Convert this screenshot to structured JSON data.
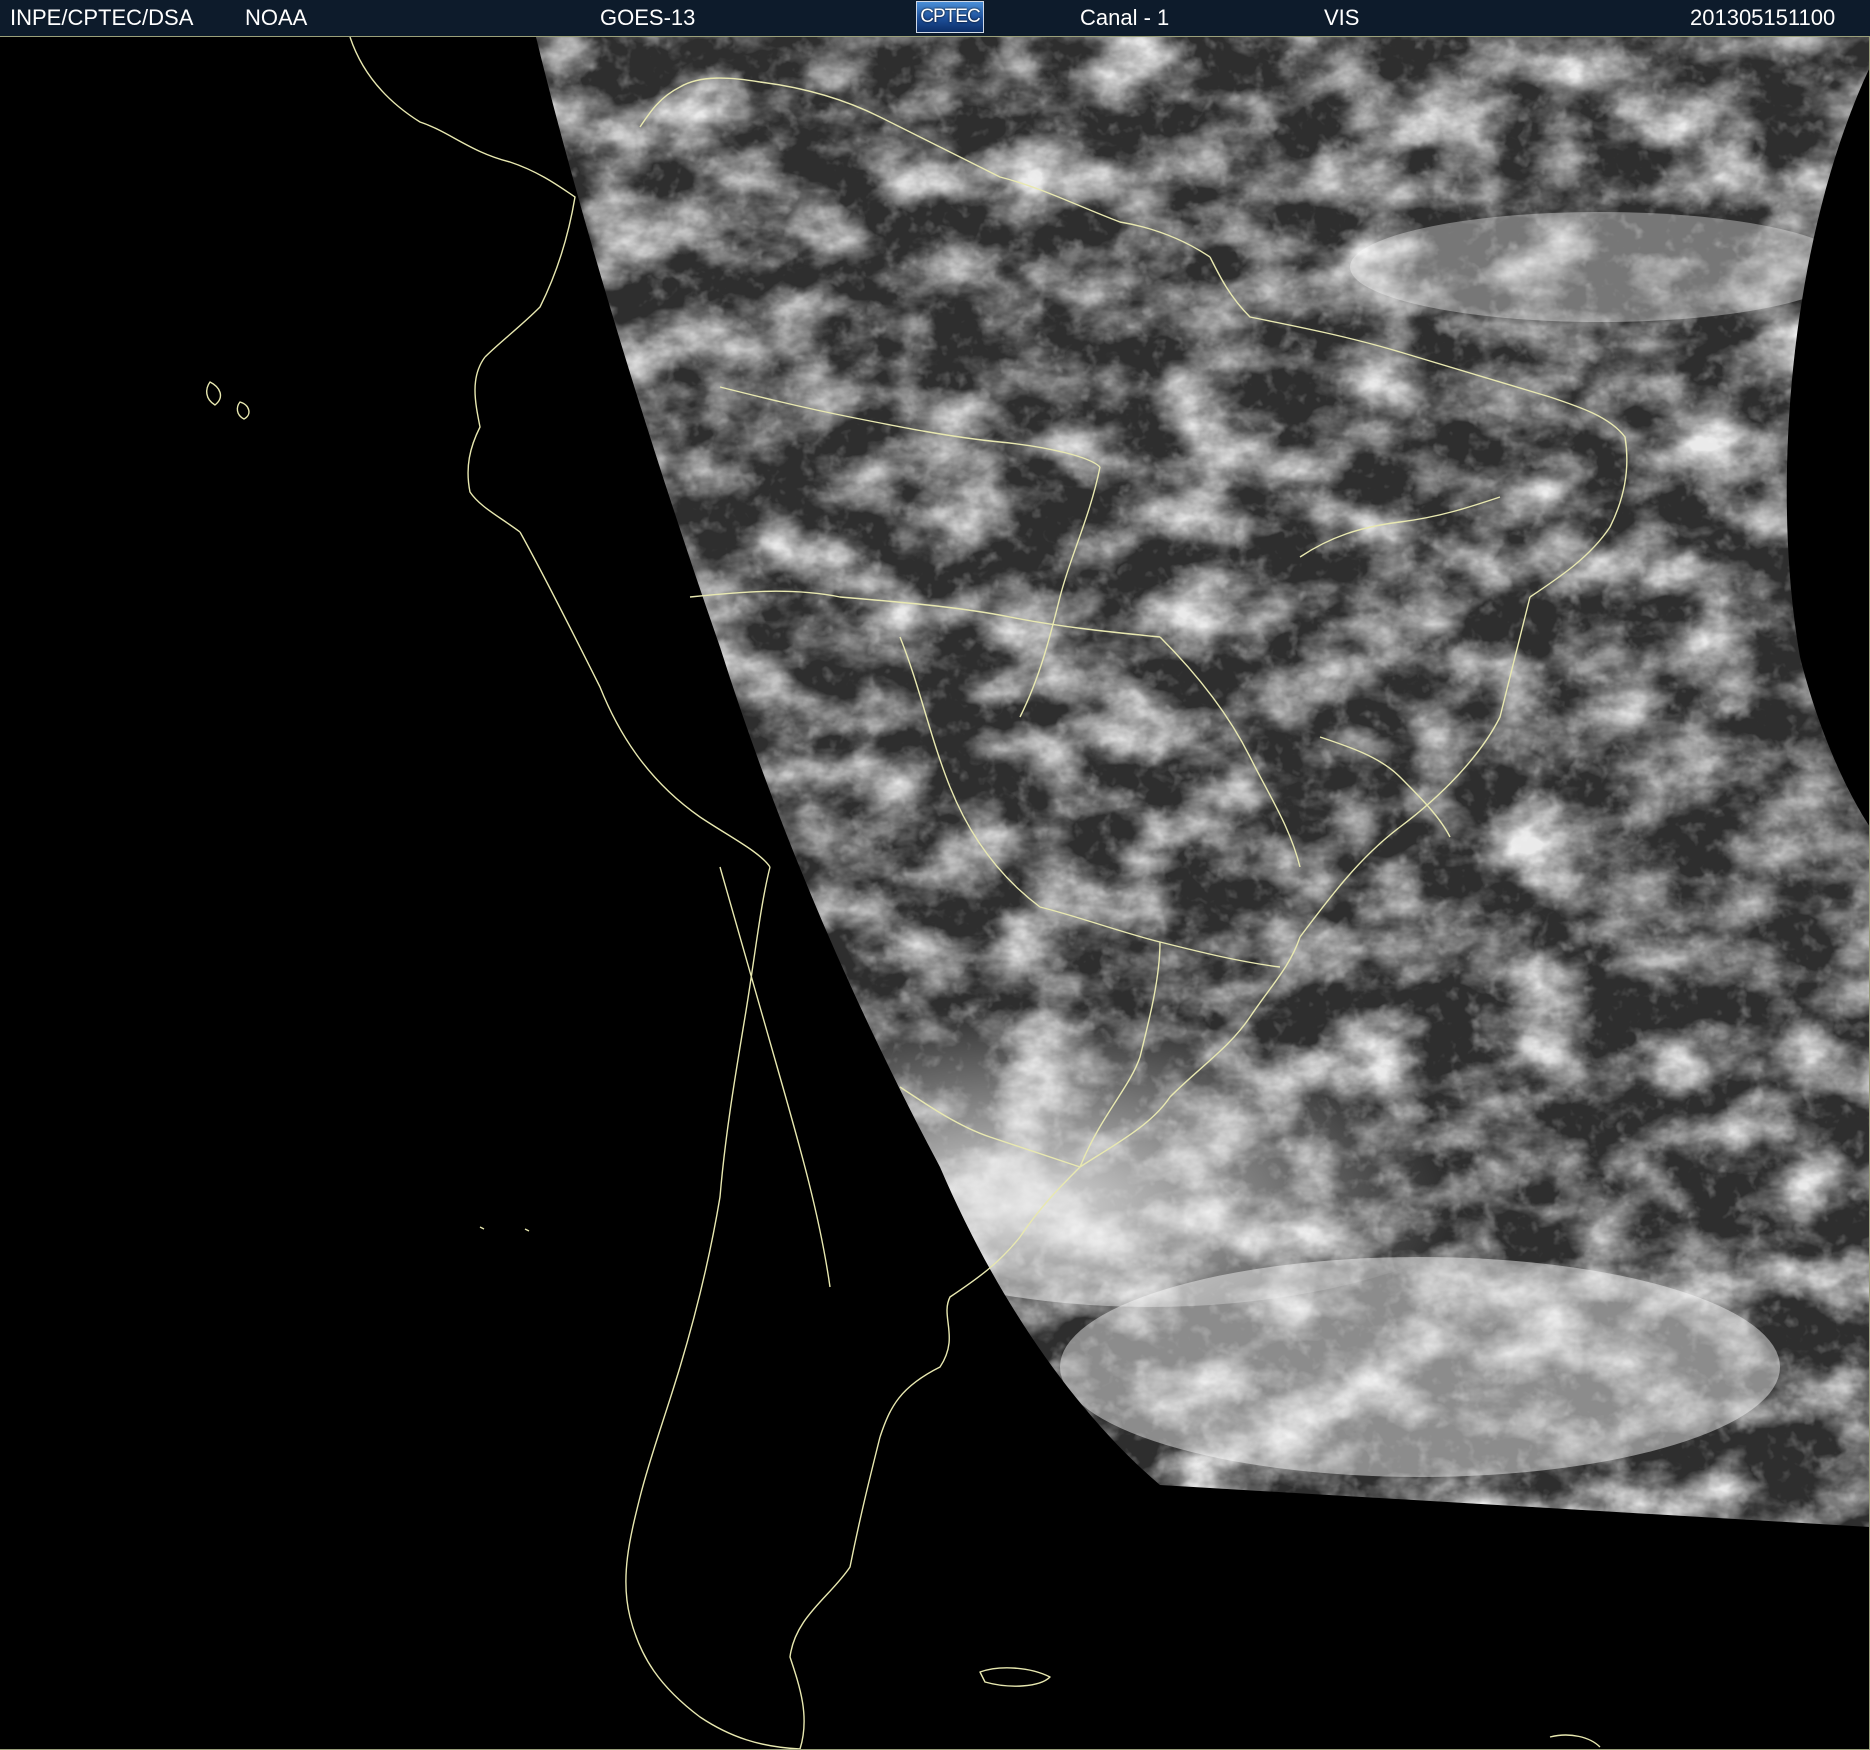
{
  "header": {
    "agency": "INPE/CPTEC/DSA",
    "provider": "NOAA",
    "satellite": "GOES-13",
    "logo_text": "CPTEC",
    "channel": "Canal - 1",
    "band": "VIS",
    "timestamp": "201305151100"
  },
  "colors": {
    "header_bg": "#0d1b2b",
    "header_text": "#ffffff",
    "coastline": "#e8e8b0",
    "space": "#000000",
    "surface_dark": "#2d2d2d",
    "cloud": "#ffffff"
  },
  "icons": {
    "logo": "cptec-logo"
  }
}
